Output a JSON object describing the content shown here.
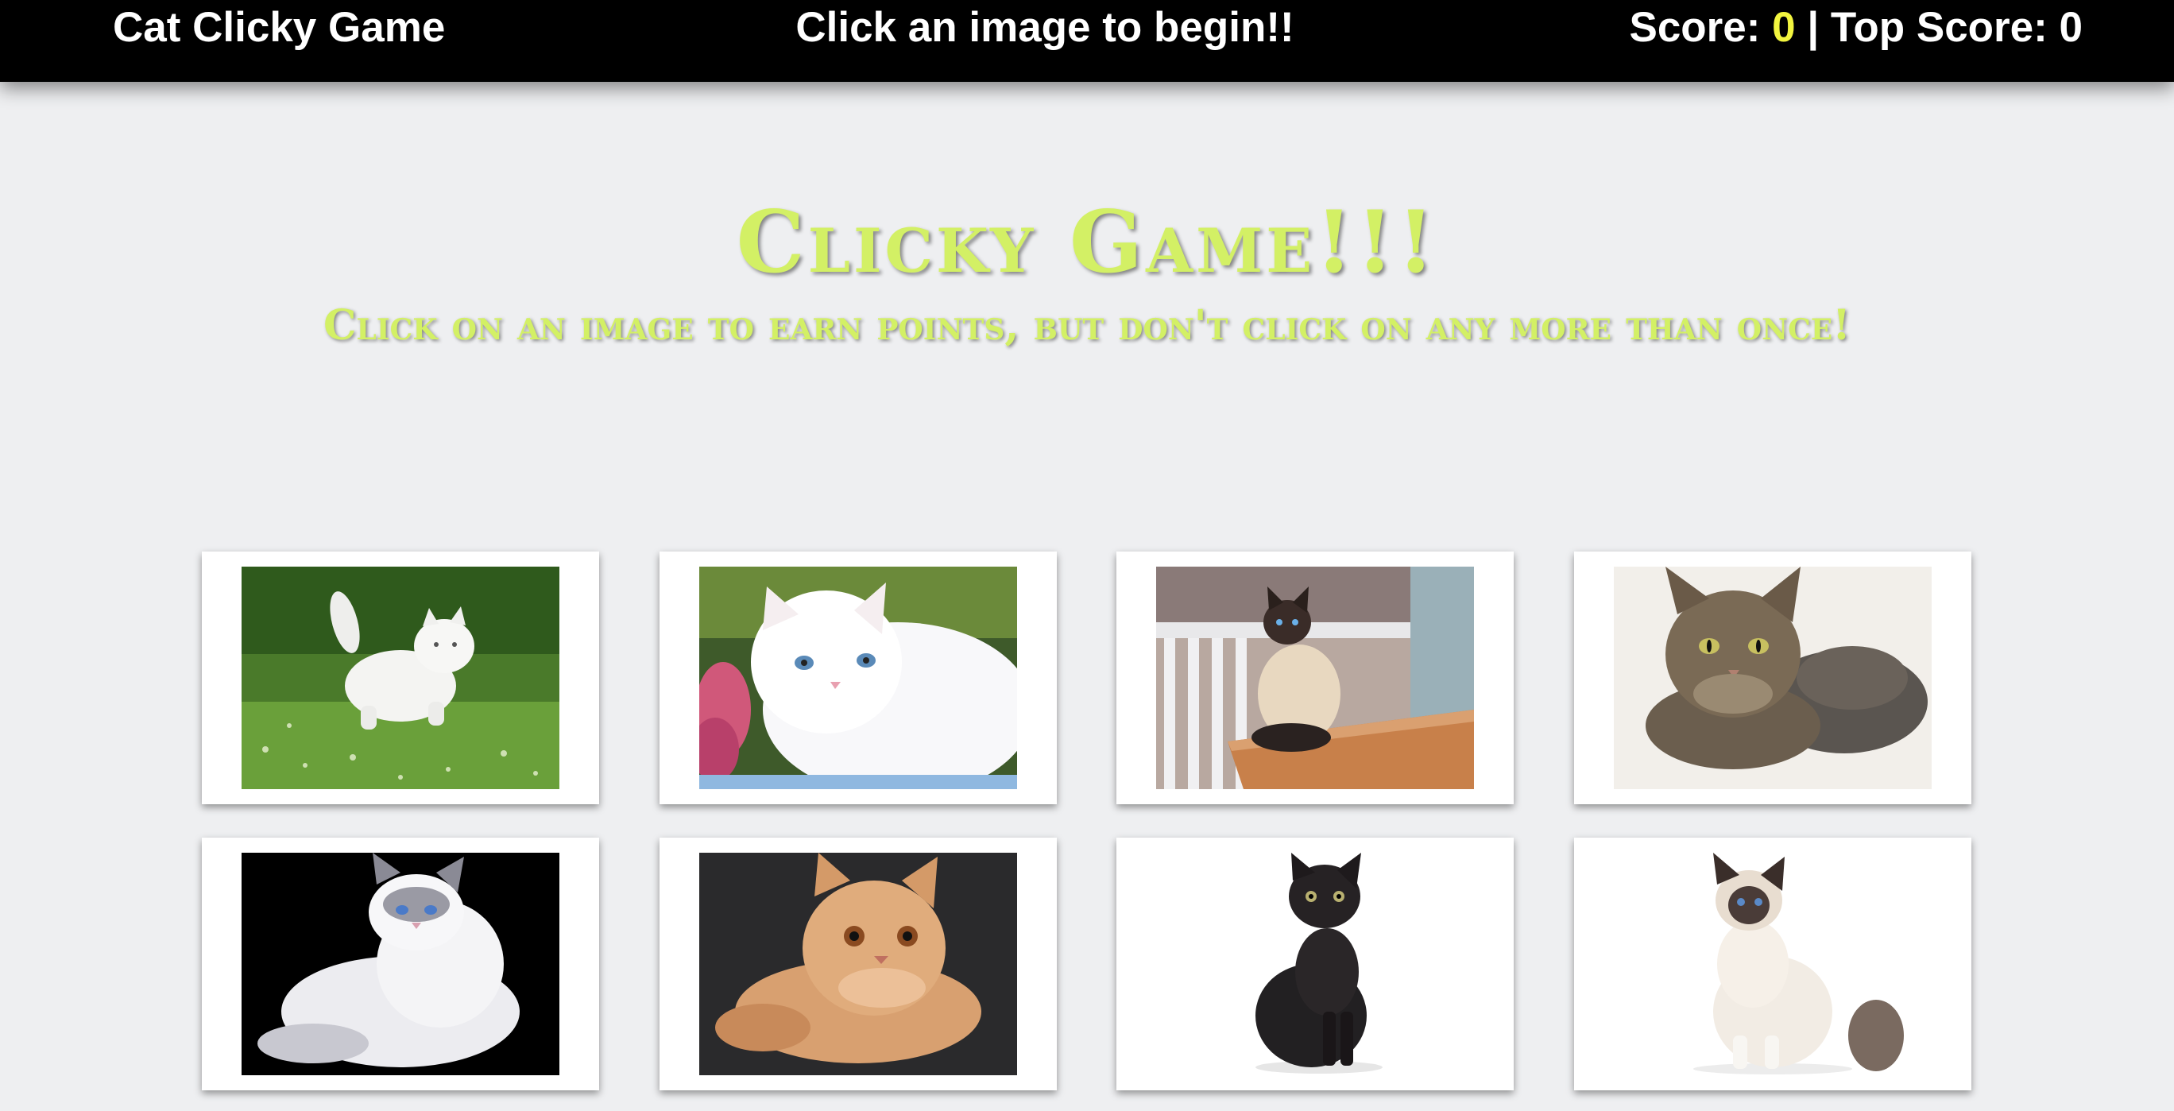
{
  "navbar": {
    "brand": "Cat Clicky Game",
    "message": "Click an image to begin!!",
    "score_label": "Score: ",
    "score": "0",
    "separator": " | ",
    "top_label": "Top Score: ",
    "top_score": "0"
  },
  "hero": {
    "title": "Clicky Game!!!",
    "subtitle": "Click on an image to earn points, but don't click on any more than once!"
  },
  "colors": {
    "accent": "#d3f065",
    "score": "#f2f53f",
    "navbar": "#000000",
    "background": "#eeeff1"
  },
  "cards": [
    {
      "name": "white-cat-grass-image"
    },
    {
      "name": "white-persian-kitten-image"
    },
    {
      "name": "siamese-cat-table-image"
    },
    {
      "name": "maine-coon-cat-image"
    },
    {
      "name": "ragdoll-cat-image"
    },
    {
      "name": "exotic-shorthair-cat-image"
    },
    {
      "name": "black-cat-image"
    },
    {
      "name": "birman-cat-image"
    }
  ]
}
